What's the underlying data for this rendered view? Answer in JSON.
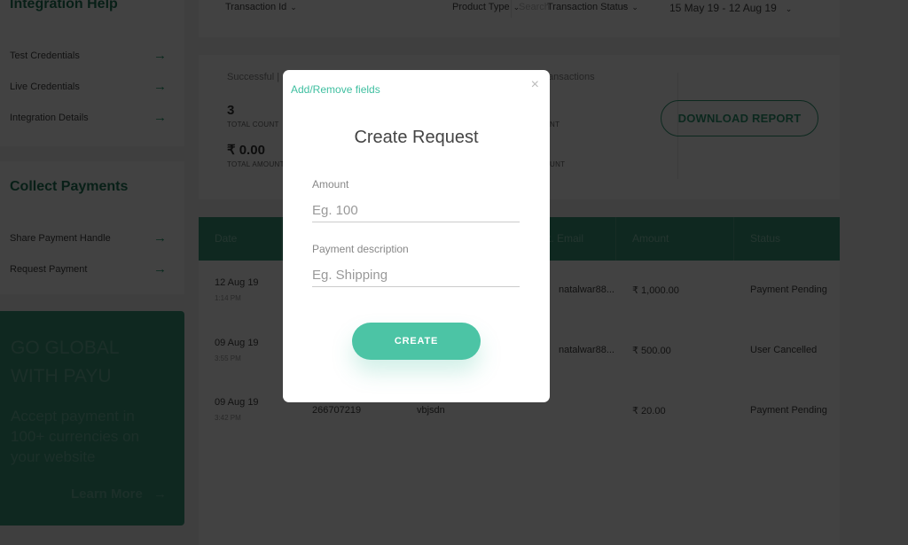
{
  "sidebar": {
    "integration_help": {
      "title": "Integration Help",
      "items": [
        {
          "label": "Test Credentials",
          "icon": "arrow-right-icon"
        },
        {
          "label": "Live Credentials",
          "icon": "arrow-right-icon"
        },
        {
          "label": "Integration Details",
          "icon": "arrow-right-icon"
        }
      ]
    },
    "collect_payments": {
      "title": "Collect Payments",
      "items": [
        {
          "label": "Share Payment Handle",
          "icon": "arrow-right-icon"
        },
        {
          "label": "Request Payment",
          "icon": "arrow-right-icon"
        }
      ]
    },
    "promo": {
      "headline": "GO GLOBAL WITH PAYU",
      "body": "Accept payment in 100+ currencies on your website",
      "link": "Learn More",
      "link_icon": "arrow-right-icon"
    }
  },
  "filters": {
    "transaction_id": "Transaction Id",
    "search_placeholder": "Search",
    "product_type": "Product Type",
    "transaction_status": "Transaction Status",
    "date_range": "15 May 19 - 12 Aug 19"
  },
  "summary": {
    "successful_label": "Successful |",
    "total_count_value": "3",
    "total_count_label": "TOTAL COUNT",
    "total_amount_value": "₹ 0.00",
    "total_amount_label": "TOTAL AMOUNT",
    "other_label": "ansactions",
    "other_count_label": "NT",
    "other_amount_label": "UNT",
    "download_button": "DOWNLOAD REPORT"
  },
  "table": {
    "headers": [
      "Date",
      "",
      "",
      "t. Email",
      "Amount",
      "Status"
    ],
    "rows": [
      {
        "date": "12 Aug 19",
        "time": "1:14 PM",
        "txn": "",
        "name": "",
        "email": "natalwar88...",
        "amount": "₹ 1,000.00",
        "status": "Payment Pending"
      },
      {
        "date": "09 Aug 19",
        "time": "3:55 PM",
        "txn": "",
        "name": "",
        "email": "natalwar88...",
        "amount": "₹ 500.00",
        "status": "User Cancelled"
      },
      {
        "date": "09 Aug 19",
        "time": "3:42 PM",
        "txn": "266707219",
        "name": "vbjsdn",
        "email": "",
        "amount": "₹ 20.00",
        "status": "Payment Pending"
      }
    ]
  },
  "modal": {
    "add_remove_link": "Add/Remove fields",
    "close_icon": "×",
    "title": "Create Request",
    "amount_label": "Amount",
    "amount_placeholder": "Eg. 100",
    "amount_value": "",
    "description_label": "Payment description",
    "description_placeholder": "Eg. Shipping",
    "description_value": "",
    "create_button": "CREATE"
  },
  "colors": {
    "brand_green": "#3c9a7d",
    "accent_teal": "#4cc4a5",
    "overlay": "rgba(0,0,0,0.74)"
  }
}
